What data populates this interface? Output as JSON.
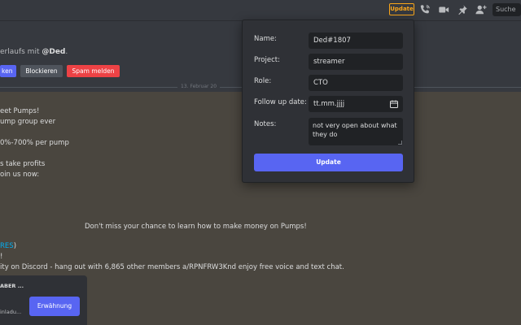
{
  "header": {
    "update_badge": "Update",
    "search_placeholder": "Suche",
    "icons": [
      "phone-icon",
      "video-icon",
      "pin-icon",
      "add-member-icon"
    ]
  },
  "top": {
    "intro_prefix": "erlaufs mit ",
    "intro_name": "@Ded",
    "intro_suffix": ".",
    "buttons": {
      "first": "ken",
      "block": "Blockieren",
      "spam": "Spam melden"
    },
    "date_divider": "13. Februar 20"
  },
  "messages": {
    "lines": [
      "eet Pumps!",
      "ump group ever",
      "0%-700% per pump",
      "s take profits",
      "oin us now:"
    ],
    "center_line": "Don't miss your chance to learn how to make money on Pumps!",
    "link_line_link": "RES",
    "link_line_suffix": ")",
    "exclaim_line": "!",
    "discord_line": "ity on Discord - hang out with 6,865 other members a/RPNFRW3Knd enjoy free voice and text chat."
  },
  "notification": {
    "title": "ABER ...",
    "subtitle": "inladu...",
    "mention_button": "Erwähnung"
  },
  "popup": {
    "name_label": "Name:",
    "name_value": "Ded#1807",
    "project_label": "Project:",
    "project_value": "streamer",
    "role_label": "Role:",
    "role_value": "CTO",
    "followup_label": "Follow up date:",
    "followup_value": "tt.mm.jjjj",
    "notes_label": "Notes:",
    "notes_value": "not very open about what they do",
    "update_button": "Update"
  },
  "colors": {
    "accent": "#5865f2",
    "danger": "#ed4245",
    "warning": "#faa61a",
    "link": "#00aff4"
  }
}
